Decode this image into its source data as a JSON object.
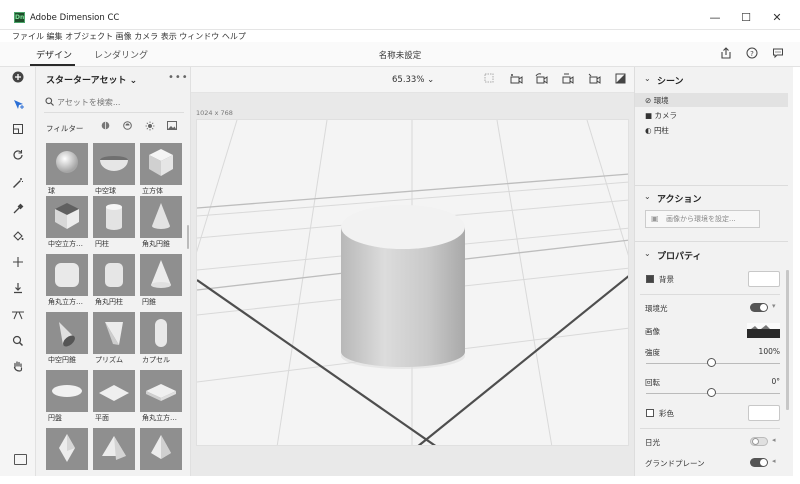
{
  "window": {
    "title": "Adobe Dimension CC",
    "logo_text": "Dn",
    "minimize": "—",
    "maximize": "☐",
    "close": "✕"
  },
  "menu": [
    "ファイル",
    "編集",
    "オブジェクト",
    "画像",
    "カメラ",
    "表示",
    "ウィンドウ",
    "ヘルプ"
  ],
  "tabs": {
    "design": "デザイン",
    "render": "レンダリング"
  },
  "document_title": "名称未設定",
  "assets": {
    "title": "スターターアセット",
    "more": "•••",
    "search_placeholder": "アセットを検索...",
    "filter_label": "フィルター",
    "items": [
      "球",
      "中空球",
      "立方体",
      "中空立方…",
      "円柱",
      "角丸円錐",
      "角丸立方…",
      "角丸円柱",
      "円錐",
      "中空円錐",
      "プリズム",
      "カプセル",
      "円盤",
      "平面",
      "角丸立方…",
      "",
      "",
      ""
    ]
  },
  "viewport": {
    "zoom": "65.33%",
    "canvas_size": "1024 x 768"
  },
  "scene": {
    "title": "シーン",
    "items": [
      {
        "label": "環境",
        "icon": "environment-icon"
      },
      {
        "label": "カメラ",
        "icon": "camera-icon"
      },
      {
        "label": "円柱",
        "icon": "cylinder-icon"
      }
    ]
  },
  "actions": {
    "title": "アクション",
    "env_from_image": "画像から環境を設定..."
  },
  "properties": {
    "title": "プロパティ",
    "background": "背景",
    "env_light": "環境光",
    "image": "画像",
    "intensity": "強度",
    "intensity_value": "100%",
    "rotation": "回転",
    "rotation_value": "0°",
    "color": "彩色",
    "sunlight": "日光",
    "ground_plane": "グランドプレーン"
  }
}
